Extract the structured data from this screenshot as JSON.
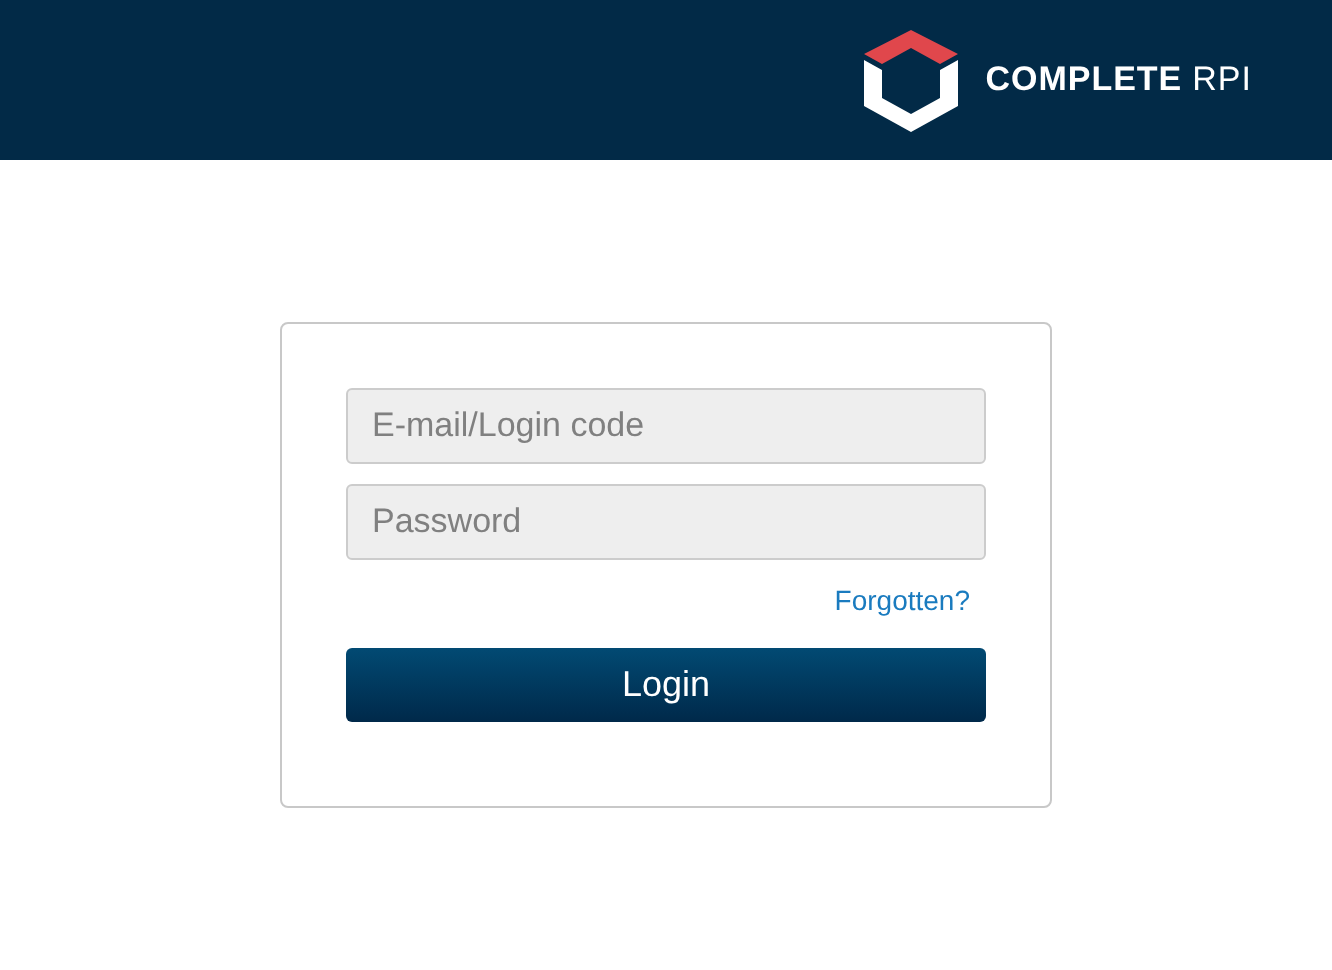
{
  "header": {
    "logo": {
      "name": "COMPLETE",
      "suffix": "RPI"
    }
  },
  "login_form": {
    "email_field": {
      "placeholder": "E-mail/Login code"
    },
    "password_field": {
      "placeholder": "Password"
    },
    "forgot_link": "Forgotten?",
    "submit_button": "Login"
  }
}
